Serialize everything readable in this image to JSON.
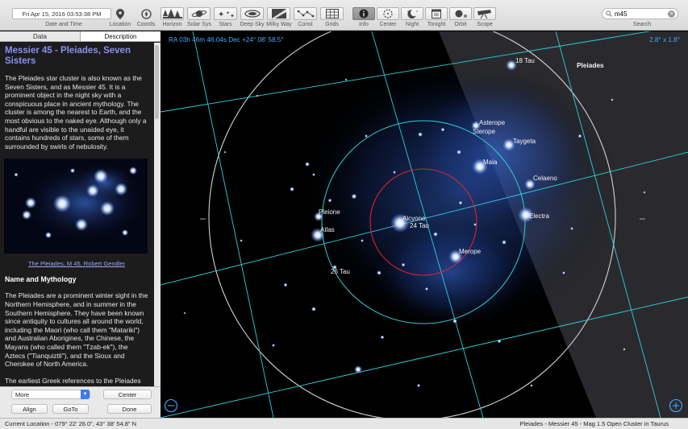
{
  "toolbar": {
    "date_time": "Fri Apr 15, 2016  03:53:38 PM",
    "date_caption": "Date and Time",
    "buttons": [
      {
        "label": "Location",
        "icon": "pin-icon"
      },
      {
        "label": "Coords",
        "icon": "compass-icon"
      },
      {
        "label": "Horizon",
        "icon": "trees-icon"
      },
      {
        "label": "Solar Sys",
        "icon": "planet-icon"
      },
      {
        "label": "Stars",
        "icon": "stars-icon"
      },
      {
        "label": "Deep Sky",
        "icon": "galaxy-icon"
      },
      {
        "label": "Milky Way",
        "icon": "milkyway-icon"
      },
      {
        "label": "Const",
        "icon": "constellation-icon"
      },
      {
        "label": "Grids",
        "icon": "grid-icon"
      },
      {
        "label": "Info",
        "icon": "info-icon"
      },
      {
        "label": "Center",
        "icon": "crosshair-icon"
      },
      {
        "label": "Night",
        "icon": "moon-icon"
      },
      {
        "label": "Tonight",
        "icon": "calendar-icon"
      },
      {
        "label": "Orbit",
        "icon": "orbit-icon"
      },
      {
        "label": "Scope",
        "icon": "telescope-icon"
      }
    ],
    "search_value": "m45",
    "search_caption": "Search"
  },
  "sidebar": {
    "tabs": [
      "Data",
      "Description"
    ],
    "title": "Messier 45 - Pleiades, Seven Sisters",
    "para1": "The Pleiades star cluster is also known as the Seven Sisters, and as Messier 45. It is a prominent object in the night sky with a conspicuous place in ancient mythology. The cluster is among the nearest to Earth, and the most obvious to the naked eye. Although only a handful are visible to the unaided eye, it contains hundreds of stars, some of them surrounded by swirls of nebulosity.",
    "caption": "The Pleiades, M 45, Robert Gendler",
    "heading": "Name and Mythology",
    "para2": "The Pleiades are a prominent winter sight in the Northern Hemisphere, and in summer in the Southern Hemisphere. They have been known since antiquity to cultures all around the world, including the Maori (who call them \"Matariki\") and Australian Aborigines, the Chinese, the Mayans (who called them \"Tzab-ek\"), the Aztecs (\"Tianquiztli\"), and the Sioux and Cherokee of North America.",
    "para3": "The earliest Greek references to the Pleiades were by Homer in the Iliad and Odyssey, around 750 and 720 B.C., and",
    "select_value": "More",
    "buttons": {
      "center": "Center",
      "align": "Align",
      "goto": "GoTo",
      "done": "Done"
    }
  },
  "sky": {
    "coords": "RA 03h 46m 46.04s Dec +24° 08' 58.5°",
    "fov": "2.8° x 1.8°",
    "object_label": "Pleiades",
    "stars": [
      {
        "name": "18 Tau"
      },
      {
        "name": "Asterope"
      },
      {
        "name": "Sterope"
      },
      {
        "name": "Taygeta"
      },
      {
        "name": "Maia"
      },
      {
        "name": "Celaeno"
      },
      {
        "name": "Electra"
      },
      {
        "name": "Pleione"
      },
      {
        "name": "Atlas"
      },
      {
        "name": "Alcyone"
      },
      {
        "name": "24 Tau"
      },
      {
        "name": "Merope"
      },
      {
        "name": "26 Tau"
      }
    ],
    "colors": {
      "grid": "#2ad1d9",
      "red_circle": "#d8242b",
      "outer_circle": "#d0d0d0",
      "accent": "#4aa8ff"
    }
  },
  "status": {
    "location": "Current Location - 079° 22' 26.0\", 43° 38' 54.8\" N",
    "object": "Pleiades - Messier 45 - Mag 1.5 Open Cluster in Taurus"
  }
}
